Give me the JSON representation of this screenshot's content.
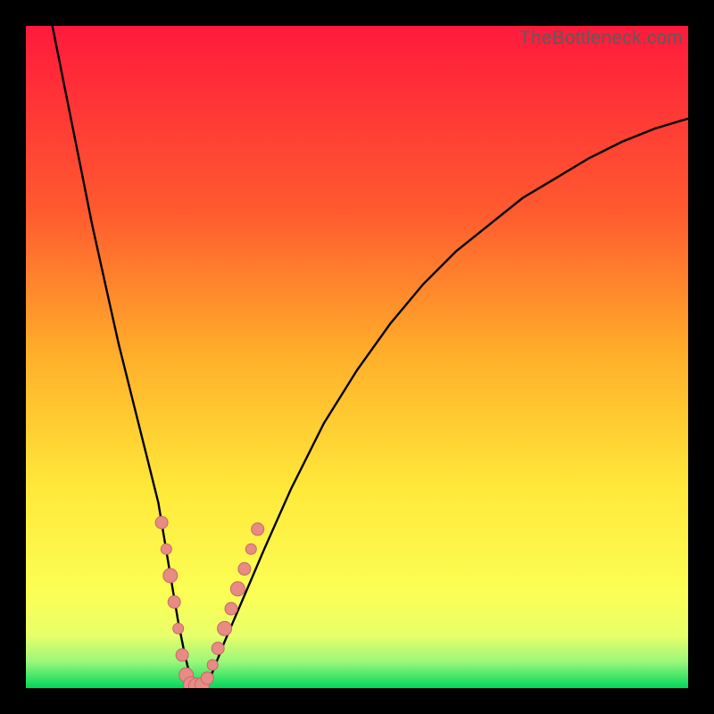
{
  "watermark": "TheBottleneck.com",
  "colors": {
    "bg_black": "#000000",
    "grad_top": "#ff1a3c",
    "grad_mid1": "#ff8a2a",
    "grad_mid2": "#ffe93a",
    "grad_low": "#f8ff70",
    "grad_bottom": "#00e060",
    "curve": "#000000",
    "marker_fill": "#e98a85",
    "marker_stroke": "#c26a65"
  },
  "chart_data": {
    "type": "line",
    "title": "",
    "xlabel": "",
    "ylabel": "",
    "xlim": [
      0,
      100
    ],
    "ylim": [
      0,
      100
    ],
    "series": [
      {
        "name": "bottleneck-curve",
        "x": [
          4,
          6,
          8,
          10,
          12,
          14,
          16,
          18,
          20,
          22,
          23,
          24,
          25,
          26,
          28,
          30,
          33,
          36,
          40,
          45,
          50,
          55,
          60,
          65,
          70,
          75,
          80,
          85,
          90,
          95,
          100
        ],
        "y": [
          100,
          90,
          80,
          70,
          61,
          52,
          44,
          36,
          28,
          16,
          10,
          5,
          1,
          0,
          2,
          7,
          14,
          21,
          30,
          40,
          48,
          55,
          61,
          66,
          70,
          74,
          77,
          80,
          82.5,
          84.5,
          86
        ]
      }
    ],
    "markers": [
      {
        "x": 20.5,
        "y": 25,
        "r": 7
      },
      {
        "x": 21.2,
        "y": 21,
        "r": 6
      },
      {
        "x": 21.8,
        "y": 17,
        "r": 8
      },
      {
        "x": 22.4,
        "y": 13,
        "r": 7
      },
      {
        "x": 23.0,
        "y": 9,
        "r": 6
      },
      {
        "x": 23.6,
        "y": 5,
        "r": 7
      },
      {
        "x": 24.2,
        "y": 2,
        "r": 8
      },
      {
        "x": 25.0,
        "y": 0.5,
        "r": 9
      },
      {
        "x": 25.8,
        "y": 0.3,
        "r": 9
      },
      {
        "x": 26.6,
        "y": 0.5,
        "r": 8
      },
      {
        "x": 27.4,
        "y": 1.5,
        "r": 7
      },
      {
        "x": 28.2,
        "y": 3.5,
        "r": 6
      },
      {
        "x": 29.0,
        "y": 6,
        "r": 7
      },
      {
        "x": 30.0,
        "y": 9,
        "r": 8
      },
      {
        "x": 31.0,
        "y": 12,
        "r": 7
      },
      {
        "x": 32.0,
        "y": 15,
        "r": 8
      },
      {
        "x": 33.0,
        "y": 18,
        "r": 7
      },
      {
        "x": 34.0,
        "y": 21,
        "r": 6
      },
      {
        "x": 35.0,
        "y": 24,
        "r": 7
      }
    ]
  }
}
